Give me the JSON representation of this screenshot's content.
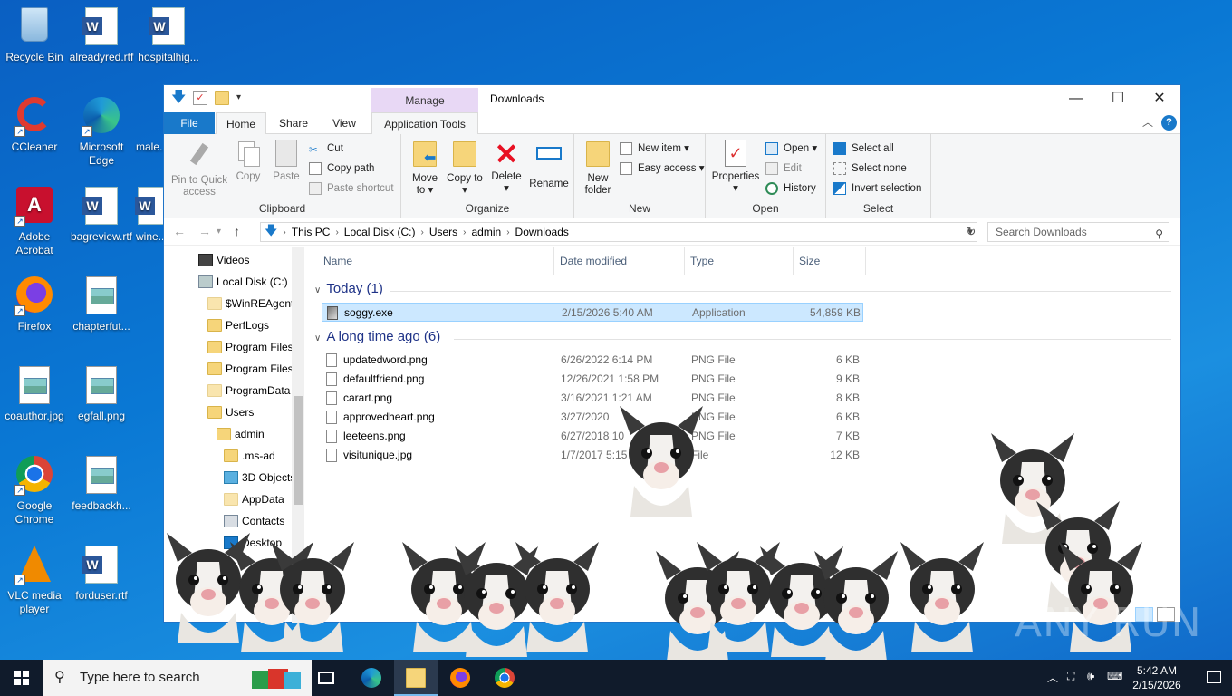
{
  "desktop": {
    "icons": [
      {
        "label": "Recycle Bin"
      },
      {
        "label": "alreadyred.rtf"
      },
      {
        "label": "hospitalhig..."
      },
      {
        "label": "CCleaner"
      },
      {
        "label": "Microsoft Edge"
      },
      {
        "label": "male..."
      },
      {
        "label": "Adobe Acrobat"
      },
      {
        "label": "bagreview.rtf"
      },
      {
        "label": "wine..."
      },
      {
        "label": "Firefox"
      },
      {
        "label": "chapterfut..."
      },
      {
        "label": "coauthor.jpg"
      },
      {
        "label": "egfall.png"
      },
      {
        "label": "Google Chrome"
      },
      {
        "label": "feedbackh..."
      },
      {
        "label": "VLC media player"
      },
      {
        "label": "forduser.rtf"
      }
    ]
  },
  "window": {
    "title": "Downloads",
    "manage_tab": "Manage",
    "controls": {
      "minimize": "—",
      "maximize": "☐",
      "close": "✕"
    },
    "tabs": {
      "file": "File",
      "home": "Home",
      "share": "Share",
      "view": "View",
      "app_tools": "Application Tools"
    }
  },
  "ribbon": {
    "clipboard": {
      "label": "Clipboard",
      "pin": "Pin to Quick access",
      "copy": "Copy",
      "paste": "Paste",
      "cut": "Cut",
      "copy_path": "Copy path",
      "paste_shortcut": "Paste shortcut"
    },
    "organize": {
      "label": "Organize",
      "move_to": "Move to",
      "copy_to": "Copy to",
      "delete": "Delete",
      "rename": "Rename"
    },
    "new": {
      "label": "New",
      "new_folder": "New folder",
      "new_item": "New item",
      "easy_access": "Easy access"
    },
    "open": {
      "label": "Open",
      "properties": "Properties",
      "open": "Open",
      "edit": "Edit",
      "history": "History"
    },
    "select": {
      "label": "Select",
      "select_all": "Select all",
      "select_none": "Select none",
      "invert": "Invert selection"
    }
  },
  "address": {
    "crumbs": [
      "This PC",
      "Local Disk (C:)",
      "Users",
      "admin",
      "Downloads"
    ],
    "search_placeholder": "Search Downloads"
  },
  "navpane": {
    "items": [
      {
        "label": "Videos"
      },
      {
        "label": "Local Disk (C:)"
      },
      {
        "label": "$WinREAgent"
      },
      {
        "label": "PerfLogs"
      },
      {
        "label": "Program Files"
      },
      {
        "label": "Program Files"
      },
      {
        "label": "ProgramData"
      },
      {
        "label": "Users"
      },
      {
        "label": "admin"
      },
      {
        "label": ".ms-ad"
      },
      {
        "label": "3D Objects"
      },
      {
        "label": "AppData"
      },
      {
        "label": "Contacts"
      },
      {
        "label": "Desktop"
      }
    ]
  },
  "filelist": {
    "columns": {
      "name": "Name",
      "date": "Date modified",
      "type": "Type",
      "size": "Size"
    },
    "groups": [
      {
        "title": "Today (1)",
        "files": [
          {
            "name": "soggy.exe",
            "date": "2/15/2026 5:40 AM",
            "type": "Application",
            "size": "54,859 KB"
          }
        ]
      },
      {
        "title": "A long time ago (6)",
        "files": [
          {
            "name": "updatedword.png",
            "date": "6/26/2022 6:14 PM",
            "type": "PNG File",
            "size": "6 KB"
          },
          {
            "name": "defaultfriend.png",
            "date": "12/26/2021 1:58 PM",
            "type": "PNG File",
            "size": "9 KB"
          },
          {
            "name": "carart.png",
            "date": "3/16/2021 1:21 AM",
            "type": "PNG File",
            "size": "8 KB"
          },
          {
            "name": "approvedheart.png",
            "date": "3/27/2020",
            "type": "PNG File",
            "size": "6 KB"
          },
          {
            "name": "leeteens.png",
            "date": "6/27/2018 10",
            "type": "PNG File",
            "size": "7 KB"
          },
          {
            "name": "visitunique.jpg",
            "date": "1/7/2017 5:15",
            "type": "File",
            "size": "12 KB"
          }
        ]
      }
    ]
  },
  "taskbar": {
    "search_placeholder": "Type here to search",
    "time": "5:42 AM",
    "date": "2/15/2026"
  },
  "watermark": "ANY RUN"
}
